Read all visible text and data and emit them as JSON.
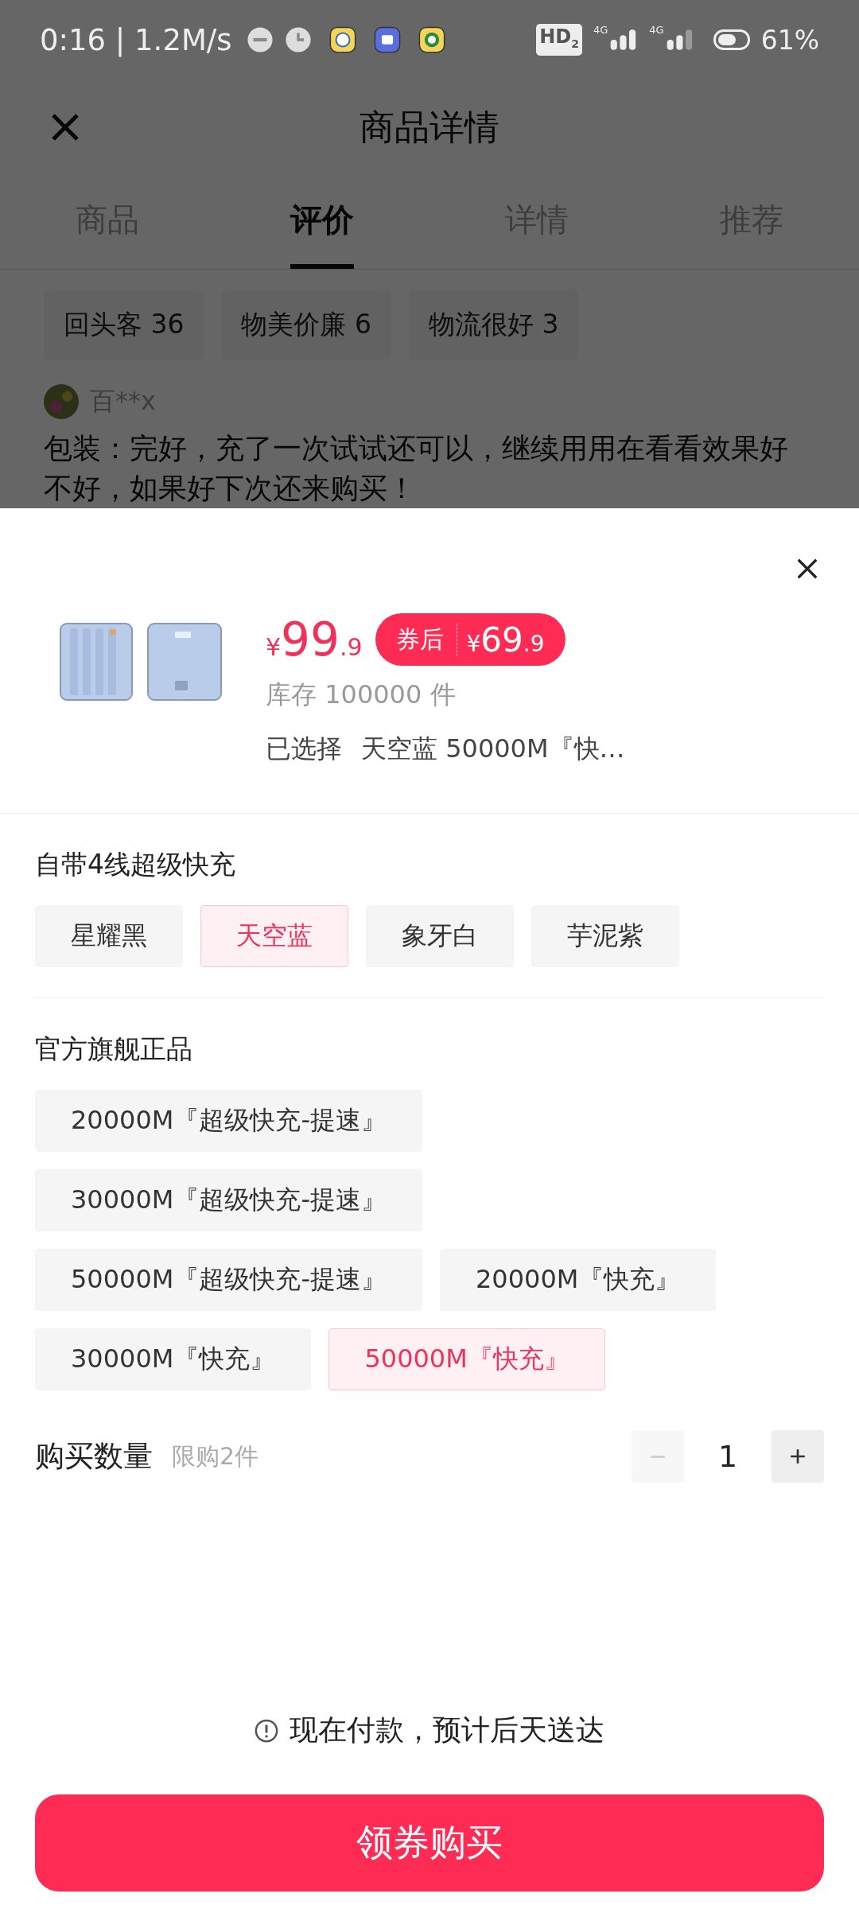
{
  "status_bar": {
    "time": "0:16 | 1.2M/s",
    "network": "HD",
    "network_sub": "2",
    "signal_label_1": "4G",
    "signal_label_2": "4G",
    "battery": "61%"
  },
  "header": {
    "title": "商品详情"
  },
  "tabs": [
    {
      "label": "商品",
      "selected": false
    },
    {
      "label": "评价",
      "selected": true
    },
    {
      "label": "详情",
      "selected": false
    },
    {
      "label": "推荐",
      "selected": false
    }
  ],
  "review_tags": [
    "回头客 36",
    "物美价廉 6",
    "物流很好 3"
  ],
  "review": {
    "user": "百**x",
    "text": "包装：完好，充了一次试试还可以，继续用用在看看效果好不好，如果好下次还来购买！"
  },
  "sheet": {
    "price": {
      "currency": "¥",
      "integer": "99",
      "decimal": ".9"
    },
    "coupon": {
      "label": "券后",
      "currency": "¥",
      "integer": "69",
      "decimal": ".9"
    },
    "stock": "库存 100000 件",
    "selected_label": "已选择",
    "selected_value": "天空蓝 50000M『快…",
    "groups": [
      {
        "title": "自带4线超级快充",
        "options": [
          {
            "label": "星耀黑",
            "selected": false
          },
          {
            "label": "天空蓝",
            "selected": true
          },
          {
            "label": "象牙白",
            "selected": false
          },
          {
            "label": "芋泥紫",
            "selected": false
          }
        ]
      },
      {
        "title": "官方旗舰正品",
        "options": [
          {
            "label": "20000M『超级快充-提速』",
            "selected": false
          },
          {
            "label": "30000M『超级快充-提速』",
            "selected": false
          },
          {
            "label": "50000M『超级快充-提速』",
            "selected": false
          },
          {
            "label": "20000M『快充』",
            "selected": false
          },
          {
            "label": "30000M『快充』",
            "selected": false
          },
          {
            "label": "50000M『快充』",
            "selected": true
          }
        ]
      }
    ],
    "quantity": {
      "label": "购买数量",
      "limit": "限购2件",
      "value": "1",
      "minus_disabled": true,
      "plus_disabled": false
    },
    "notice": "现在付款，预计后天送达",
    "button": "领券购买"
  }
}
